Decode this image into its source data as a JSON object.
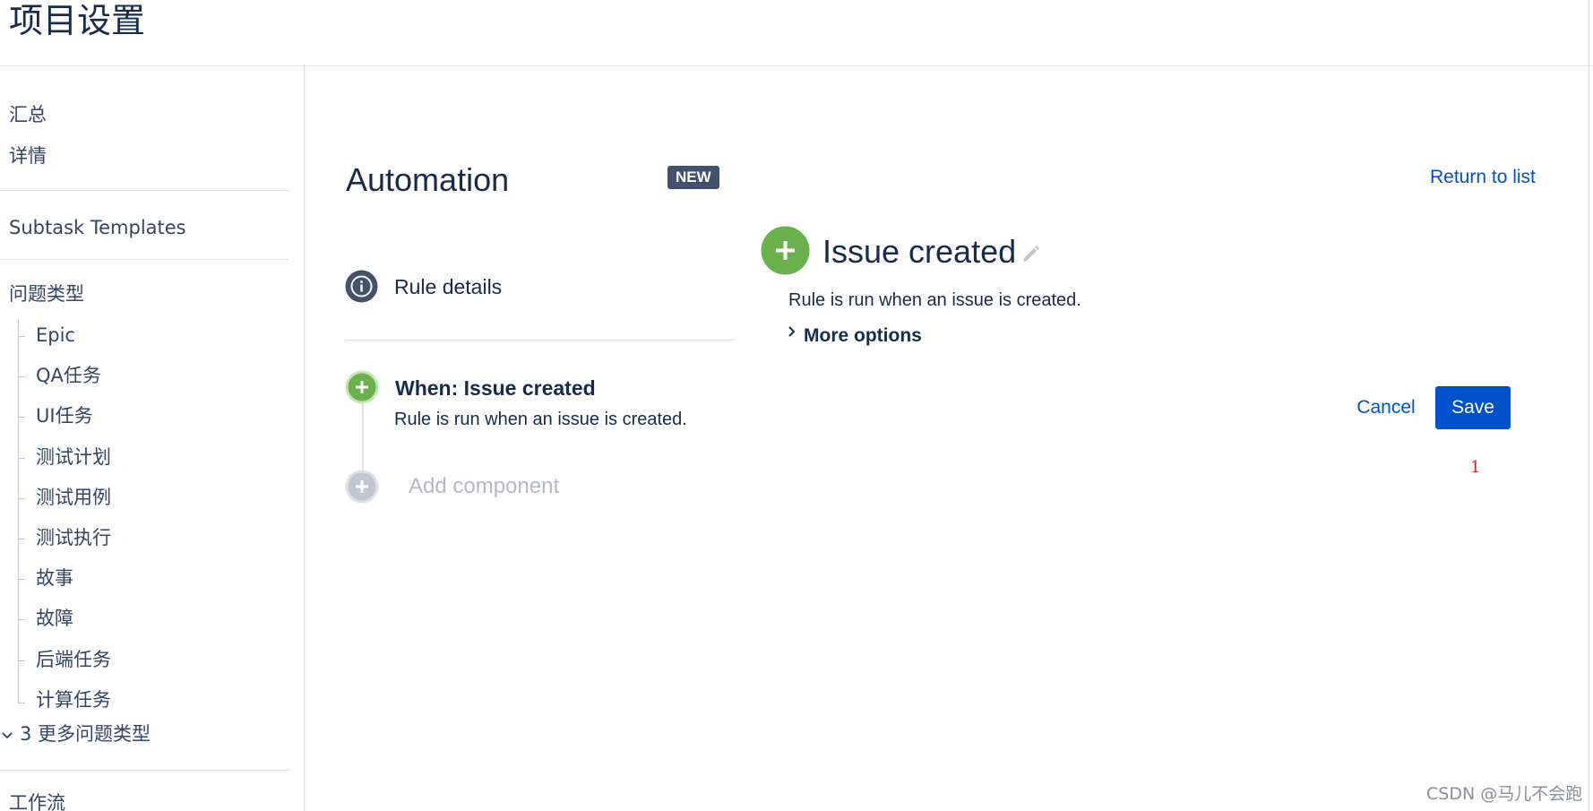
{
  "header": {
    "title": "项目设置"
  },
  "sidebar": {
    "items": [
      {
        "label": "汇总"
      },
      {
        "label": "详情"
      },
      {
        "label": "Subtask Templates"
      },
      {
        "label": "问题类型"
      }
    ],
    "issue_types": [
      {
        "label": "Epic"
      },
      {
        "label": "QA任务"
      },
      {
        "label": "UI任务"
      },
      {
        "label": "测试计划"
      },
      {
        "label": "测试用例"
      },
      {
        "label": "测试执行"
      },
      {
        "label": "故事"
      },
      {
        "label": "故障"
      },
      {
        "label": "后端任务"
      },
      {
        "label": "计算任务"
      }
    ],
    "more_types": {
      "icon": "chevron-down-icon",
      "label": "3 更多问题类型"
    },
    "workflow": {
      "label": "工作流"
    }
  },
  "automation": {
    "title": "Automation",
    "badge": "NEW",
    "return_link": "Return to list",
    "rule_details": {
      "icon": "info-icon",
      "label": "Rule details"
    },
    "trigger": {
      "icon": "plus-circle-icon",
      "title": "When: Issue created",
      "description": "Rule is run when an issue is created."
    },
    "add_component": {
      "icon": "plus-circle-icon",
      "label": "Add component"
    }
  },
  "detail": {
    "icon": "plus-circle-icon",
    "title": "Issue created",
    "edit_icon": "pencil-icon",
    "description": "Rule is run when an issue is created.",
    "more_options": "More options",
    "cancel_label": "Cancel",
    "save_label": "Save",
    "annotation": "1"
  },
  "watermark": "CSDN @马儿不会跑",
  "colors": {
    "accent": "#0052cc",
    "trigger_green": "#6ab04c",
    "badge": "#42526e",
    "annotation_red": "#e0201b"
  }
}
